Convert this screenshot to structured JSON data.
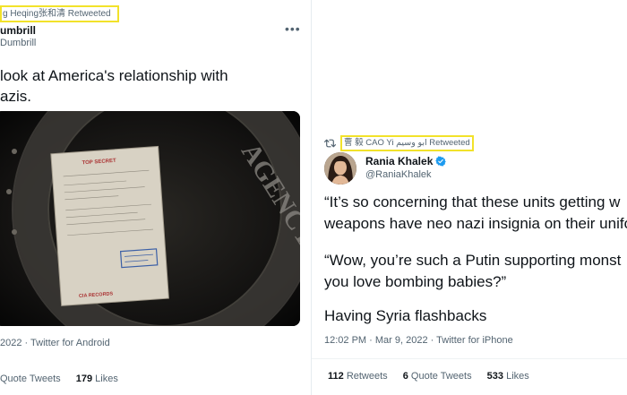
{
  "left_tweet": {
    "retweet_banner": "g Heqing张和清 Retweeted",
    "author_name": "umbrill",
    "author_handle": "Dumbrill",
    "more_icon": "more-horizontal-icon",
    "text_line1": "look at America's relationship with",
    "text_line2": "azis.",
    "media_text_top": "TOP SECRET",
    "media_text_bottom": "CIA RECORDS",
    "media_watermark": "AGENCY",
    "timestamp": "2022 · Twitter for Android",
    "stats": {
      "quote_tweets_label": "Quote Tweets",
      "likes_count": "179",
      "likes_label": "Likes"
    }
  },
  "right_tweet": {
    "retweet_icon": "retweet-icon",
    "retweet_banner": "曹 毅 CAO Yi ابو وسيم Retweeted",
    "author_name": "Rania Khalek",
    "author_handle": "@RaniaKhalek",
    "verified_icon": "verified-badge-icon",
    "para1_line1": "“It’s so concerning that these units getting w",
    "para1_line2": "weapons have neo nazi insignia on their unifo",
    "para2_line1": "“Wow, you’re such a Putin supporting monst",
    "para2_line2": "you love bombing  babies?”",
    "para3": "Having Syria flashbacks",
    "timestamp": "12:02 PM · Mar 9, 2022 · Twitter for iPhone",
    "stats": {
      "retweets_count": "112",
      "retweets_label": "Retweets",
      "quote_tweets_count": "6",
      "quote_tweets_label": "Quote Tweets",
      "likes_count": "533",
      "likes_label": "Likes"
    }
  },
  "colors": {
    "highlight_box": "#f2e22a",
    "secondary_text": "#536471",
    "primary_text": "#0f1419",
    "verified_blue": "#1d9bf0"
  }
}
